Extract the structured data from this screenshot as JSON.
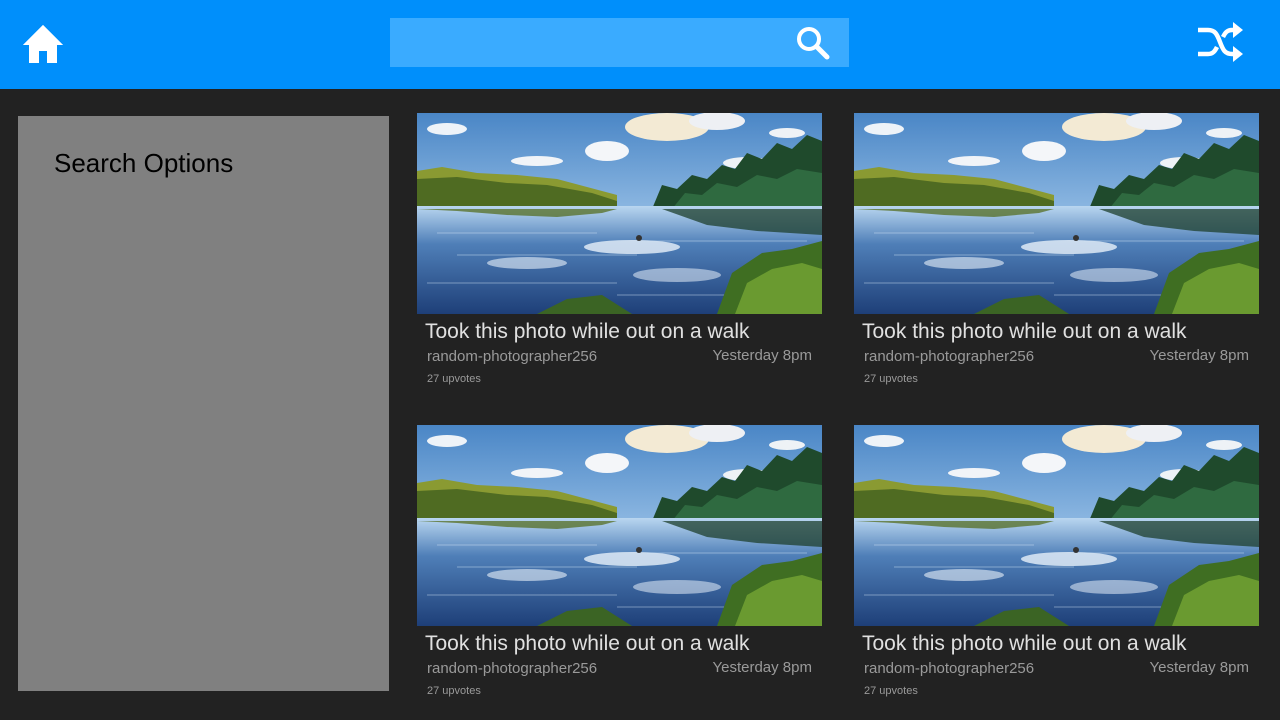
{
  "header": {
    "home_icon": "home-icon",
    "search": {
      "value": "",
      "placeholder": "",
      "icon": "search-icon"
    },
    "shuffle_icon": "shuffle-icon",
    "colors": {
      "bar": "#008ffb",
      "search_field": "#3aabff"
    }
  },
  "sidebar": {
    "title": "Search Options",
    "background": "#808080"
  },
  "posts": [
    {
      "title": "Took this photo while out on a walk",
      "author": "random-photographer256",
      "time": "Yesterday 8pm",
      "votes": "27 upvotes"
    },
    {
      "title": "Took this photo while out on a walk",
      "author": "random-photographer256",
      "time": "Yesterday 8pm",
      "votes": "27 upvotes"
    },
    {
      "title": "Took this photo while out on a walk",
      "author": "random-photographer256",
      "time": "Yesterday 8pm",
      "votes": "27 upvotes"
    },
    {
      "title": "Took this photo while out on a walk",
      "author": "random-photographer256",
      "time": "Yesterday 8pm",
      "votes": "27 upvotes"
    }
  ]
}
